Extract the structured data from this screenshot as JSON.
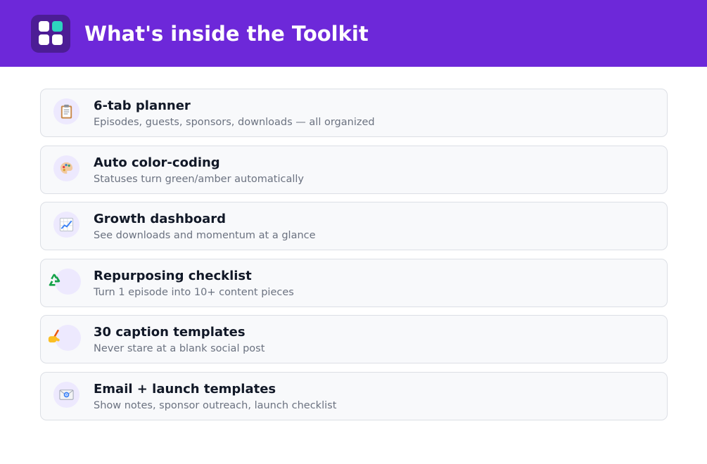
{
  "header": {
    "title": "What's inside the Toolkit",
    "logo_icon": "grid-app-icon",
    "background_color": "#6d28d9",
    "logo_accent_color": "#2dd4bf"
  },
  "features": [
    {
      "icon": "clipboard-icon",
      "title": "6-tab planner",
      "description": "Episodes, guests, sponsors, downloads — all organized"
    },
    {
      "icon": "palette-icon",
      "title": "Auto color-coding",
      "description": "Statuses turn green/amber automatically"
    },
    {
      "icon": "chart-increasing-icon",
      "title": "Growth dashboard",
      "description": "See downloads and momentum at a glance"
    },
    {
      "icon": "recycle-icon",
      "title": "Repurposing checklist",
      "description": "Turn 1 episode into 10+ content pieces"
    },
    {
      "icon": "writing-hand-icon",
      "title": "30 caption templates",
      "description": "Never stare at a blank social post"
    },
    {
      "icon": "email-icon",
      "title": "Email + launch templates",
      "description": "Show notes, sponsor outreach, launch checklist"
    }
  ]
}
